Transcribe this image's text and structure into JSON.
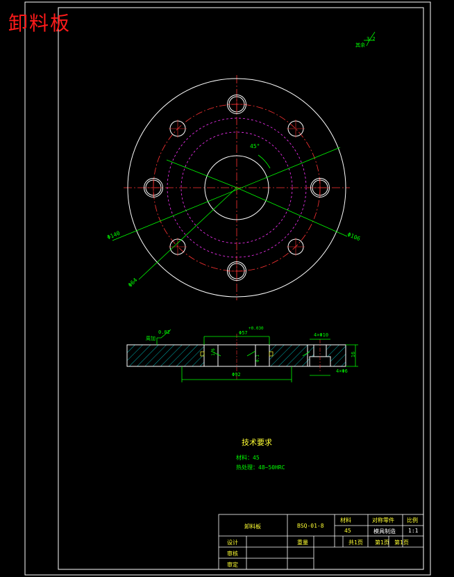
{
  "title": "卸料板",
  "roughness_note": {
    "label": "其余",
    "value": "3.2"
  },
  "top_view": {
    "dim_outer": "Φ140",
    "dim_bolt_circle": "Φ106",
    "dim_inner": "Φ64",
    "angle": "45°"
  },
  "section_view": {
    "dim_flatness": "0.02",
    "dim_flatness_label": "周加",
    "dim_bore": "Φ57",
    "dim_bore_tol": "+0.030",
    "dim_step": "Φ92",
    "dim_chamfer": "1.6",
    "dim_depth": "0.1",
    "dim_holes_top": "4×Φ10",
    "dim_holes_bottom": "4×Φ6",
    "dim_thickness": "16"
  },
  "tech_requirements": {
    "heading": "技术要求",
    "material": "材料：45",
    "hardness": "热处理：48~50HRC"
  },
  "title_block": {
    "part_name": "卸料板",
    "drawing_no": "BSQ-01-8",
    "material_label": "材料",
    "material_value": "45",
    "company": "对称零件",
    "mold": "模具制造",
    "scale_label": "比例",
    "scale_value": "1:1",
    "design_label": "设计",
    "check_label": "审核",
    "approve_label": "审定",
    "weight_label": "重量",
    "sheet_total": "共1页",
    "sheet_no": "第1页",
    "sheet_label": "第1页"
  }
}
